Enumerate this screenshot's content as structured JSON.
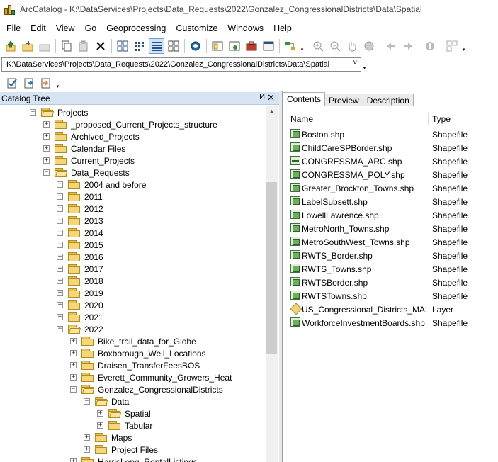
{
  "window": {
    "title": "ArcCatalog - K:\\DataServices\\Projects\\Data_Requests\\2022\\Gonzalez_CongressionalDistricts\\Data\\Spatial"
  },
  "menu": [
    "File",
    "Edit",
    "View",
    "Go",
    "Geoprocessing",
    "Customize",
    "Windows",
    "Help"
  ],
  "location": {
    "value": "K:\\DataServices\\Projects\\Data_Requests\\2022\\Gonzalez_CongressionalDistricts\\Data\\Spatial"
  },
  "catalog_tree": {
    "title": "Catalog Tree",
    "pin_glyph": "И",
    "close_glyph": "✕",
    "items": [
      {
        "label": "Projects",
        "expander": "−",
        "open": true
      },
      {
        "label": "_proposed_Current_Projects_structure",
        "expander": "+",
        "open": false
      },
      {
        "label": "Archived_Projects",
        "expander": "+",
        "open": false
      },
      {
        "label": "Calendar Files",
        "expander": "+",
        "open": false
      },
      {
        "label": "Current_Projects",
        "expander": "+",
        "open": false
      },
      {
        "label": "Data_Requests",
        "expander": "−",
        "open": true
      },
      {
        "label": "2004 and before",
        "expander": "+",
        "open": false
      },
      {
        "label": "2011",
        "expander": "+",
        "open": false
      },
      {
        "label": "2012",
        "expander": "+",
        "open": false
      },
      {
        "label": "2013",
        "expander": "+",
        "open": false
      },
      {
        "label": "2014",
        "expander": "+",
        "open": false
      },
      {
        "label": "2015",
        "expander": "+",
        "open": false
      },
      {
        "label": "2016",
        "expander": "+",
        "open": false
      },
      {
        "label": "2017",
        "expander": "+",
        "open": false
      },
      {
        "label": "2018",
        "expander": "+",
        "open": false
      },
      {
        "label": "2019",
        "expander": "+",
        "open": false
      },
      {
        "label": "2020",
        "expander": "+",
        "open": false
      },
      {
        "label": "2021",
        "expander": "+",
        "open": false
      },
      {
        "label": "2022",
        "expander": "−",
        "open": true
      },
      {
        "label": "Bike_trail_data_for_Globe",
        "expander": "+",
        "open": false
      },
      {
        "label": "Boxborough_Well_Locations",
        "expander": "+",
        "open": false
      },
      {
        "label": "Draisen_TransferFeesBOS",
        "expander": "+",
        "open": false
      },
      {
        "label": "Everett_Community_Growers_Heat",
        "expander": "+",
        "open": false
      },
      {
        "label": "Gonzalez_CongressionalDistricts",
        "expander": "−",
        "open": true
      },
      {
        "label": "Data",
        "expander": "−",
        "open": true
      },
      {
        "label": "Spatial",
        "expander": "+",
        "open": true
      },
      {
        "label": "Tabular",
        "expander": "+",
        "open": false
      },
      {
        "label": "Maps",
        "expander": "+",
        "open": false
      },
      {
        "label": "Project Files",
        "expander": "+",
        "open": false
      },
      {
        "label": "HarrisLong_RentalListings",
        "expander": "+",
        "open": false
      }
    ]
  },
  "tabs": [
    "Contents",
    "Preview",
    "Description"
  ],
  "contents": {
    "columns": [
      "Name",
      "Type"
    ],
    "rows": [
      {
        "name": "Boston.shp",
        "type": "Shapefile",
        "icon": "polygon-shapefile-icon"
      },
      {
        "name": "ChildCareSPBorder.shp",
        "type": "Shapefile",
        "icon": "polygon-shapefile-icon"
      },
      {
        "name": "CONGRESSMA_ARC.shp",
        "type": "Shapefile",
        "icon": "line-shapefile-icon"
      },
      {
        "name": "CONGRESSMA_POLY.shp",
        "type": "Shapefile",
        "icon": "polygon-shapefile-icon"
      },
      {
        "name": "Greater_Brockton_Towns.shp",
        "type": "Shapefile",
        "icon": "polygon-shapefile-icon"
      },
      {
        "name": "LabelSubsett.shp",
        "type": "Shapefile",
        "icon": "polygon-shapefile-icon"
      },
      {
        "name": "LowellLawrence.shp",
        "type": "Shapefile",
        "icon": "polygon-shapefile-icon"
      },
      {
        "name": "MetroNorth_Towns.shp",
        "type": "Shapefile",
        "icon": "polygon-shapefile-icon"
      },
      {
        "name": "MetroSouthWest_Towns.shp",
        "type": "Shapefile",
        "icon": "polygon-shapefile-icon"
      },
      {
        "name": "RWTS_Border.shp",
        "type": "Shapefile",
        "icon": "polygon-shapefile-icon"
      },
      {
        "name": "RWTS_Towns.shp",
        "type": "Shapefile",
        "icon": "polygon-shapefile-icon"
      },
      {
        "name": "RWTSBorder.shp",
        "type": "Shapefile",
        "icon": "polygon-shapefile-icon"
      },
      {
        "name": "RWTSTowns.shp",
        "type": "Shapefile",
        "icon": "polygon-shapefile-icon"
      },
      {
        "name": "US_Congressional_Districts_MA...",
        "type": "Layer",
        "icon": "layer-file-icon"
      },
      {
        "name": "WorkforceInvestmentBoards.shp",
        "type": "Shapefile",
        "icon": "polygon-shapefile-icon"
      }
    ]
  },
  "toolbar_glyphs": {
    "dropdown": "▾",
    "scroll_up": "▲",
    "combo_arrow": "∨"
  }
}
